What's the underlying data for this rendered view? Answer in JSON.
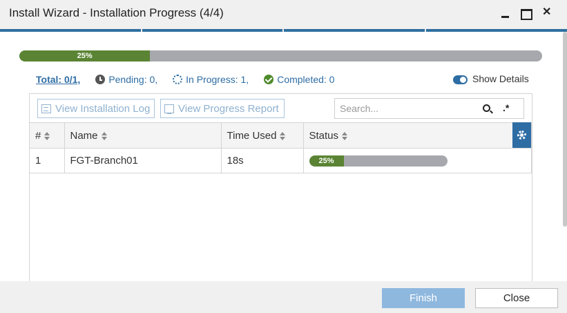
{
  "window": {
    "title": "Install Wizard - Installation Progress (4/4)",
    "minimize_icon": "minimize-icon",
    "maximize_icon": "maximize-icon",
    "close_glyph": "✕"
  },
  "overall_progress": {
    "percent": 25,
    "label": "25%",
    "fill_color": "#5a8433",
    "track_color": "#a6a8ad"
  },
  "summary": {
    "total": "Total: 0/1,",
    "pending": "Pending: 0,",
    "in_progress": "In Progress: 1,",
    "completed": "Completed: 0",
    "show_details_label": "Show Details",
    "show_details_on": true
  },
  "toolbar": {
    "view_log_label": "View Installation Log",
    "view_report_label": "View Progress Report",
    "search_placeholder": "Search...",
    "regex_glyph": ".*"
  },
  "table": {
    "columns": [
      "#",
      "Name",
      "Time Used",
      "Status"
    ],
    "rows": [
      {
        "index": "1",
        "name": "FGT-Branch01",
        "time_used": "18s",
        "status_percent": 25,
        "status_label": "25%"
      }
    ]
  },
  "footer": {
    "finish_label": "Finish",
    "close_label": "Close"
  },
  "colors": {
    "accent": "#2e6da4",
    "progress_fill": "#5a8433",
    "finish_button": "#8fb8de"
  }
}
